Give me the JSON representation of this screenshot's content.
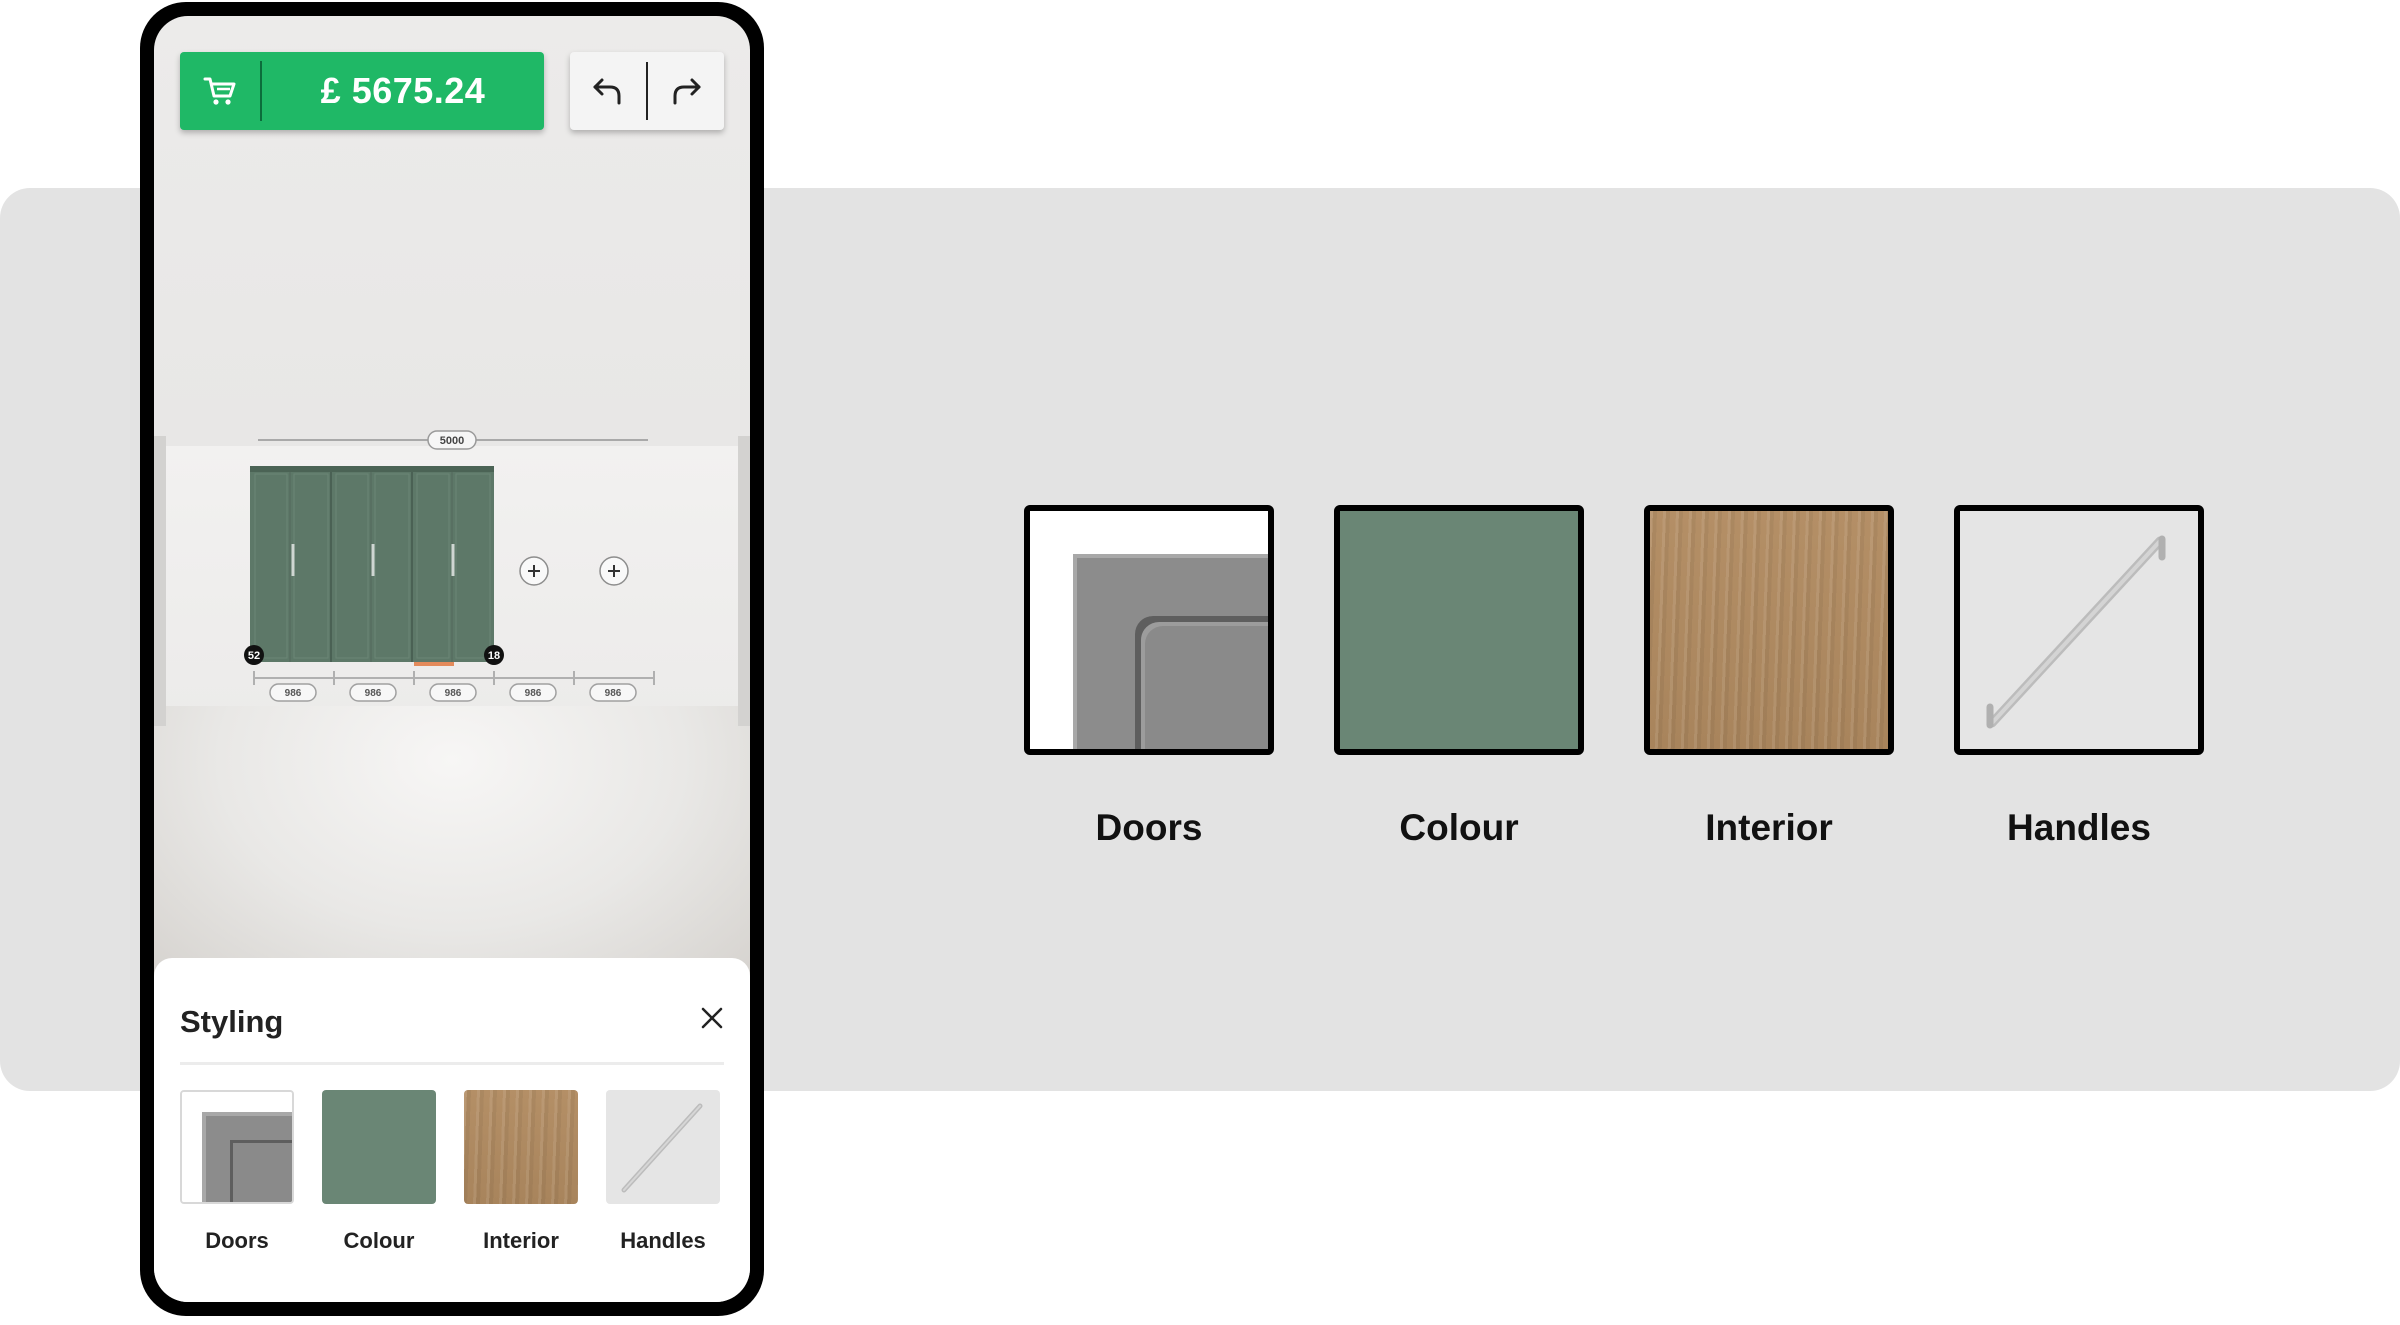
{
  "header": {
    "price": "£ 5675.24"
  },
  "room": {
    "total_width": "5000",
    "left_badge": "52",
    "right_badge": "18",
    "section_widths": [
      "986",
      "986",
      "986",
      "986",
      "986"
    ]
  },
  "styling_panel": {
    "title": "Styling",
    "options": [
      {
        "label": "Doors"
      },
      {
        "label": "Colour"
      },
      {
        "label": "Interior"
      },
      {
        "label": "Handles"
      }
    ]
  },
  "showcase": {
    "options": [
      {
        "label": "Doors"
      },
      {
        "label": "Colour"
      },
      {
        "label": "Interior"
      },
      {
        "label": "Handles"
      }
    ]
  },
  "colors": {
    "accent_green": "#1fb866",
    "wardrobe_green": "#6a8675",
    "oak": "#ad8860"
  },
  "icons": {
    "cart": "cart-icon",
    "undo": "undo-icon",
    "redo": "redo-icon",
    "close": "close-icon",
    "add": "plus-icon"
  }
}
